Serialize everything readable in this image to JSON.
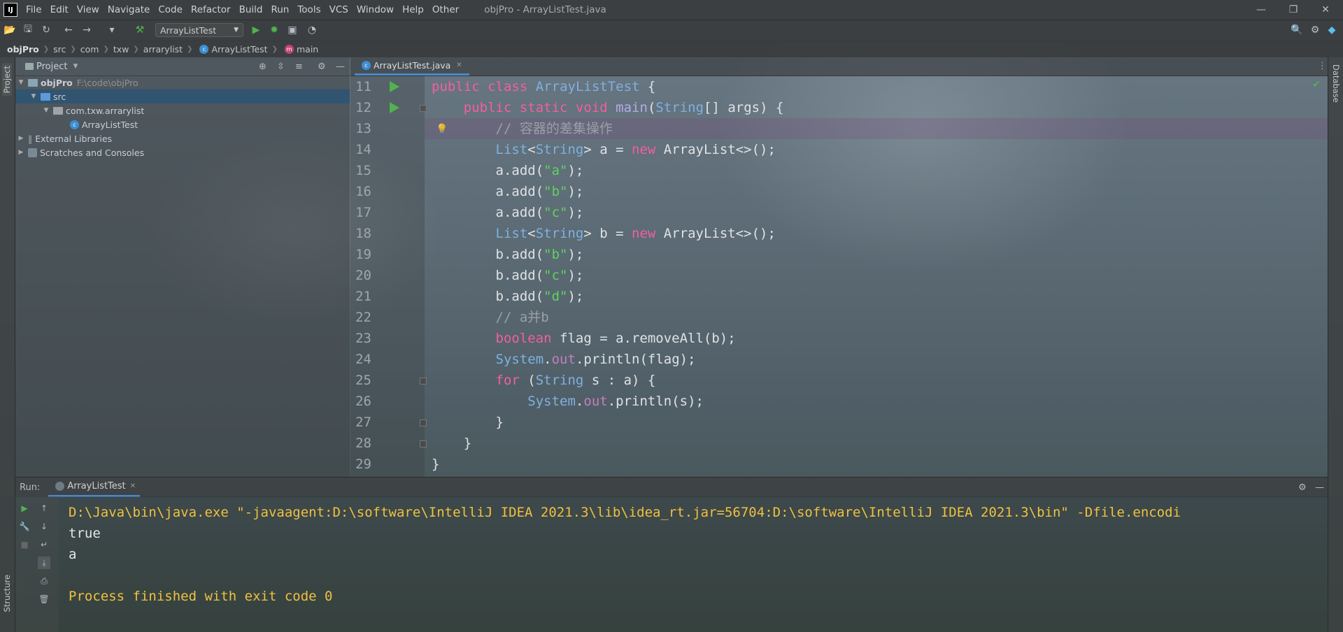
{
  "titlebar": {
    "logo": "IJ",
    "menus": [
      "File",
      "Edit",
      "View",
      "Navigate",
      "Code",
      "Refactor",
      "Build",
      "Run",
      "Tools",
      "VCS",
      "Window",
      "Help",
      "Other"
    ],
    "title": "objPro - ArrayListTest.java"
  },
  "toolbar": {
    "run_config": "ArrayListTest"
  },
  "breadcrumb": [
    "objPro",
    "src",
    "com",
    "txw",
    "arrarylist",
    "ArrayListTest",
    "main"
  ],
  "sidebar": {
    "project_tab": "Project",
    "structure_tab": "Structure",
    "database_tab": "Database"
  },
  "project": {
    "header": "Project",
    "root_name": "objPro",
    "root_path": "F:\\code\\objPro",
    "src": "src",
    "package": "com.txw.arrarylist",
    "class": "ArrayListTest",
    "external": "External Libraries",
    "scratches": "Scratches and Consoles"
  },
  "editor": {
    "tab": "ArrayListTest.java",
    "line_numbers": [
      "11",
      "12",
      "13",
      "14",
      "15",
      "16",
      "17",
      "18",
      "19",
      "20",
      "21",
      "22",
      "23",
      "24",
      "25",
      "26",
      "27",
      "28",
      "29"
    ]
  },
  "code": {
    "l11": [
      "public",
      "class",
      "ArrayListTest",
      "{"
    ],
    "l12": [
      "public",
      "static",
      "void",
      "main",
      "(",
      "String",
      "[] args) {"
    ],
    "l13": "// 容器的差集操作",
    "l14": [
      "List",
      "<",
      "String",
      "> a = ",
      "new",
      " ArrayList<>();"
    ],
    "l15": [
      "a.add(",
      "\"a\"",
      ");"
    ],
    "l16": [
      "a.add(",
      "\"b\"",
      ");"
    ],
    "l17": [
      "a.add(",
      "\"c\"",
      ");"
    ],
    "l18": [
      "List",
      "<",
      "String",
      "> b = ",
      "new",
      " ArrayList<>();"
    ],
    "l19": [
      "b.add(",
      "\"b\"",
      ");"
    ],
    "l20": [
      "b.add(",
      "\"c\"",
      ");"
    ],
    "l21": [
      "b.add(",
      "\"d\"",
      ");"
    ],
    "l22": "// a并b",
    "l23": [
      "boolean",
      " flag = a.removeAll(b);"
    ],
    "l24": [
      "System",
      ".",
      "out",
      ".println(flag);"
    ],
    "l25": [
      "for",
      " (",
      "String",
      " s : a) {"
    ],
    "l26": [
      "System",
      ".",
      "out",
      ".println(s);"
    ],
    "l27": "}",
    "l28": "}",
    "l29": "}"
  },
  "run": {
    "label": "Run:",
    "tab": "ArrayListTest",
    "console": [
      "D:\\Java\\bin\\java.exe \"-javaagent:D:\\software\\IntelliJ IDEA 2021.3\\lib\\idea_rt.jar=56704:D:\\software\\IntelliJ IDEA 2021.3\\bin\" -Dfile.encodi",
      "true",
      "a",
      "",
      "Process finished with exit code 0"
    ]
  },
  "colors": {
    "keyword": "#f25fa0",
    "class": "#7fb0e0",
    "string": "#5fd35f",
    "console_cmd": "#f0c040"
  }
}
